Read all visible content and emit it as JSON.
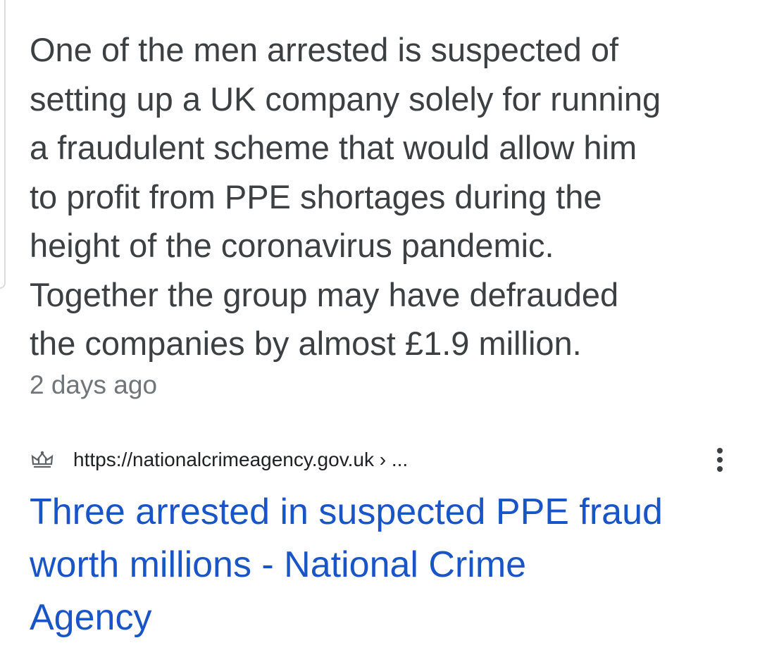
{
  "snippet": {
    "lines": [
      "One of the men arrested is suspected of",
      "setting up a UK company solely for running",
      "a fraudulent scheme that would allow him",
      "to profit from PPE shortages during the",
      "height of the coronavirus pandemic.",
      "Together the group may have defrauded",
      "the companies by almost £1.9 million."
    ],
    "timestamp": "2 days ago"
  },
  "result": {
    "favicon": "crown-icon",
    "url": "https://nationalcrimeagency.gov.uk › ...",
    "more_icon": "more-vert-icon",
    "title_lines": [
      "Three arrested in suspected PPE fraud",
      "worth millions - National Crime",
      "Agency"
    ]
  },
  "colors": {
    "snippet_text": "#3c4043",
    "timestamp": "#70757a",
    "link": "#1a55c8",
    "url_text": "#202124"
  }
}
